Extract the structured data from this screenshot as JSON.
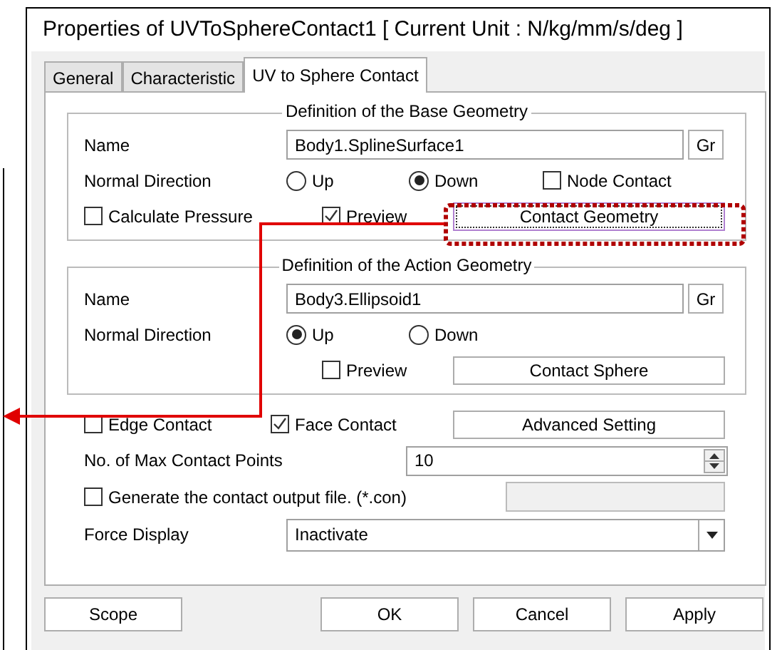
{
  "window": {
    "title": "Properties of UVToSphereContact1 [ Current Unit : N/kg/mm/s/deg ]"
  },
  "tabs": [
    {
      "label": "General",
      "selected": false
    },
    {
      "label": "Characteristic",
      "selected": false
    },
    {
      "label": "UV to Sphere Contact",
      "selected": true
    }
  ],
  "base_geometry": {
    "title": "Definition of the Base Geometry",
    "name_label": "Name",
    "name_value": "Body1.SplineSurface1",
    "gr_button": "Gr",
    "normal_label": "Normal Direction",
    "normal_options": [
      {
        "label": "Up",
        "selected": false
      },
      {
        "label": "Down",
        "selected": true
      }
    ],
    "node_contact": {
      "label": "Node Contact",
      "checked": false
    },
    "calculate_pressure": {
      "label": "Calculate Pressure",
      "checked": false
    },
    "preview": {
      "label": "Preview",
      "checked": true
    },
    "button": {
      "label": "Contact Geometry",
      "highlighted": true
    }
  },
  "action_geometry": {
    "title": "Definition of the Action Geometry",
    "name_label": "Name",
    "name_value": "Body3.Ellipsoid1",
    "gr_button": "Gr",
    "normal_label": "Normal Direction",
    "normal_options": [
      {
        "label": "Up",
        "selected": true
      },
      {
        "label": "Down",
        "selected": false
      }
    ],
    "preview": {
      "label": "Preview",
      "checked": false
    },
    "button": {
      "label": "Contact Sphere",
      "highlighted": false
    }
  },
  "edge_contact": {
    "label": "Edge Contact",
    "checked": false
  },
  "face_contact": {
    "label": "Face Contact",
    "checked": true
  },
  "advanced_button": "Advanced Setting",
  "max_contact_points": {
    "label": "No. of Max Contact Points",
    "value": "10"
  },
  "generate_output": {
    "label": "Generate the contact output file. (*.con)",
    "checked": false
  },
  "force_display": {
    "label": "Force Display",
    "value": "Inactivate"
  },
  "footer_buttons": [
    "Scope",
    "OK",
    "Cancel",
    "Apply"
  ]
}
